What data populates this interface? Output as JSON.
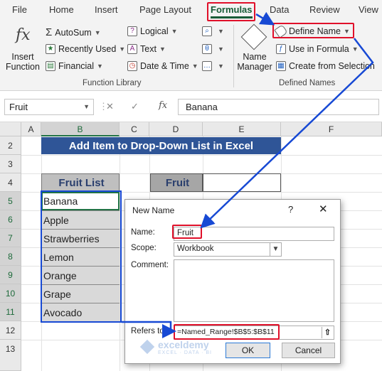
{
  "ribbon": {
    "tabs": [
      "File",
      "Home",
      "Insert",
      "Page Layout",
      "Formulas",
      "Data",
      "Review",
      "View"
    ],
    "active_tab": "Formulas",
    "insert_function": [
      "Insert",
      "Function"
    ],
    "function_library": {
      "autosum": "AutoSum",
      "recently_used": "Recently Used",
      "financial": "Financial",
      "logical": "Logical",
      "text": "Text",
      "date_time": "Date & Time",
      "group_label": "Function Library"
    },
    "defined_names": {
      "name_manager": [
        "Name",
        "Manager"
      ],
      "define_name": "Define Name",
      "use_in_formula": "Use in Formula",
      "create_from_selection": "Create from Selection",
      "group_label": "Defined Names"
    }
  },
  "formula_bar": {
    "name_box": "Fruit",
    "fx_label": "fx",
    "content": "Banana"
  },
  "sheet": {
    "columns": [
      "A",
      "B",
      "C",
      "D",
      "E",
      "F"
    ],
    "rows": [
      "2",
      "3",
      "4",
      "5",
      "6",
      "7",
      "8",
      "9",
      "10",
      "11",
      "12",
      "13"
    ],
    "title": "Add Item to Drop-Down List in Excel",
    "list_header": "Fruit List",
    "fruits": [
      "Banana",
      "Apple",
      "Strawberries",
      "Lemon",
      "Orange",
      "Grape",
      "Avocado"
    ],
    "lookup_label": "Fruit"
  },
  "dialog": {
    "title": "New Name",
    "help": "?",
    "name_label": "Name:",
    "name_value": "Fruit",
    "scope_label": "Scope:",
    "scope_value": "Workbook",
    "comment_label": "Comment:",
    "refers_label": "Refers to:",
    "refers_value": "=Named_Range!$B$5:$B$11",
    "ok": "OK",
    "cancel": "Cancel"
  },
  "watermark": {
    "brand": "exceldemy",
    "tagline": "EXCEL · DATA · BI"
  },
  "colors": {
    "excel_green": "#217346",
    "title_fill": "#2f5597",
    "header_fill": "#bfbfbf",
    "list_fill": "#d9d9d9",
    "highlight_red": "#e0102a",
    "highlight_blue": "#1749d4"
  }
}
